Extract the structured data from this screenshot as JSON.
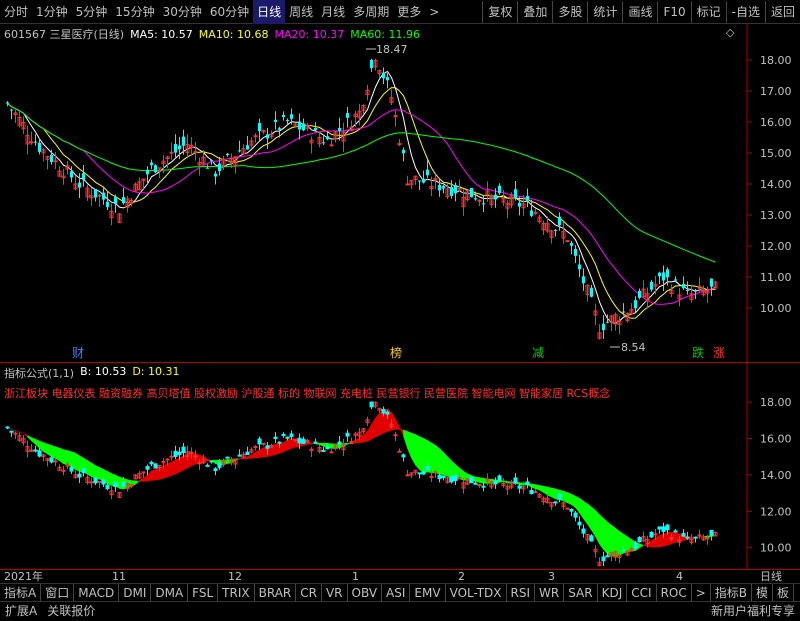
{
  "topbar": {
    "periods": [
      "分时",
      "1分钟",
      "5分钟",
      "15分钟",
      "30分钟",
      "60分钟",
      "日线",
      "周线",
      "月线",
      "多周期",
      "更多"
    ],
    "selected": "日线",
    "more_arrow": ">",
    "buttons": [
      "复权",
      "叠加",
      "多股",
      "统计",
      "画线",
      "F10",
      "标记",
      "-自选",
      "返回"
    ]
  },
  "main": {
    "code_name": "601567 三星医疗(日线)",
    "diamond": "◇",
    "ma": [
      {
        "label": "MA5: 10.57",
        "color": "#ffffff"
      },
      {
        "label": "MA10: 10.68",
        "color": "#ffff00"
      },
      {
        "label": "MA20: 10.37",
        "color": "#ff00ff"
      },
      {
        "label": "MA60: 11.96",
        "color": "#00ff00"
      }
    ],
    "y_ticks": [
      "18.00",
      "17.00",
      "16.00",
      "15.00",
      "14.00",
      "13.00",
      "12.00",
      "11.00",
      "10.00"
    ],
    "high_label": "18.47",
    "low_label": "8.54",
    "markers": [
      {
        "text": "财",
        "color": "#4080ff"
      },
      {
        "text": "榜",
        "color": "#ffcc00"
      },
      {
        "text": "减",
        "color": "#00cc00"
      },
      {
        "text": "跌",
        "color": "#00cc00"
      },
      {
        "text": "涨",
        "color": "#ff3030"
      }
    ]
  },
  "indicator": {
    "title": "指标公式(1,1)",
    "b_label": "B: 10.53",
    "d_label": "D: 10.31",
    "concepts": "浙江板块 电器仪表 融资融券 高贝塔值 股权激励 沪股通 标的 物联网 充电桩 民营银行 民营医院 智能电网 智能家居 RCS概念",
    "y_ticks": [
      "18.00",
      "16.00",
      "14.00",
      "12.00",
      "10.00"
    ]
  },
  "xaxis": {
    "labels": [
      "2021年",
      "11",
      "12",
      "1",
      "2",
      "3",
      "4"
    ],
    "period": "日线"
  },
  "indicator_tabs": [
    "指标A",
    "窗口",
    "MACD",
    "DMI",
    "DMA",
    "FSL",
    "TRIX",
    "BRAR",
    "CR",
    "VR",
    "OBV",
    "ASI",
    "EMV",
    "VOL-TDX",
    "RSI",
    "WR",
    "SAR",
    "KDJ",
    "CCI",
    "ROC",
    "指标B",
    "模",
    "板"
  ],
  "indicator_tab_arrow": ">",
  "statusbar": {
    "left": [
      "扩展A",
      "关联报价"
    ],
    "right": "新用户福利专享"
  },
  "colors": {
    "up": "#ff3030",
    "down": "#00ffff",
    "frame": "#b00000",
    "band_up": "#e00000",
    "band_down": "#00ff00"
  }
}
